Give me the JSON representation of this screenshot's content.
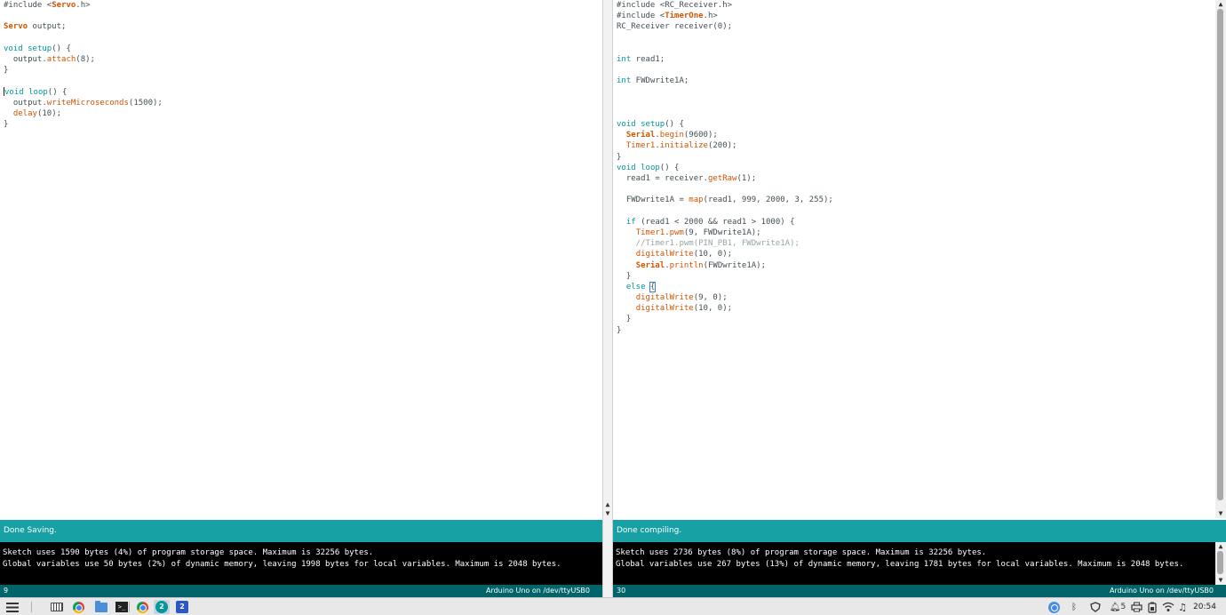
{
  "left_window": {
    "code_lines": [
      [
        {
          "t": "#include <",
          "c": ""
        },
        {
          "t": "Servo",
          "c": "ty"
        },
        {
          "t": ".h>",
          "c": ""
        }
      ],
      [],
      [
        {
          "t": "Servo",
          "c": "ty"
        },
        {
          "t": " output;",
          "c": ""
        }
      ],
      [],
      [
        {
          "t": "void",
          "c": "kw"
        },
        {
          "t": " ",
          "c": ""
        },
        {
          "t": "setup",
          "c": "kw"
        },
        {
          "t": "() {",
          "c": ""
        }
      ],
      [
        {
          "t": "  output.",
          "c": ""
        },
        {
          "t": "attach",
          "c": "fn"
        },
        {
          "t": "(8);",
          "c": ""
        }
      ],
      [
        {
          "t": "}",
          "c": ""
        }
      ],
      [],
      [
        {
          "t": "void",
          "c": "kw",
          "cursor": true
        },
        {
          "t": " ",
          "c": ""
        },
        {
          "t": "loop",
          "c": "kw"
        },
        {
          "t": "() {",
          "c": ""
        }
      ],
      [
        {
          "t": "  output.",
          "c": ""
        },
        {
          "t": "writeMicroseconds",
          "c": "fn"
        },
        {
          "t": "(1500);",
          "c": ""
        }
      ],
      [
        {
          "t": "  ",
          "c": ""
        },
        {
          "t": "delay",
          "c": "fn"
        },
        {
          "t": "(10);",
          "c": ""
        }
      ],
      [
        {
          "t": "}",
          "c": ""
        }
      ]
    ],
    "status_text": "Done Saving.",
    "console_lines": [
      "Sketch uses 1590 bytes (4%) of program storage space. Maximum is 32256 bytes.",
      "Global variables use 50 bytes (2%) of dynamic memory, leaving 1998 bytes for local variables. Maximum is 2048 bytes."
    ],
    "line_number": "9",
    "board": "Arduino Uno on /dev/ttyUSB0"
  },
  "right_window": {
    "code_lines": [
      [
        {
          "t": "#include <",
          "c": ""
        },
        {
          "t": "RC_Receiver",
          "c": ""
        },
        {
          "t": ".h>",
          "c": ""
        }
      ],
      [
        {
          "t": "#include <",
          "c": ""
        },
        {
          "t": "TimerOne",
          "c": "ty"
        },
        {
          "t": ".h>",
          "c": ""
        }
      ],
      [
        {
          "t": "RC_Receiver receiver(0);",
          "c": ""
        }
      ],
      [],
      [],
      [
        {
          "t": "int",
          "c": "kw"
        },
        {
          "t": " read1;",
          "c": ""
        }
      ],
      [],
      [
        {
          "t": "int",
          "c": "kw"
        },
        {
          "t": " FWDwrite1A;",
          "c": ""
        }
      ],
      [],
      [],
      [],
      [
        {
          "t": "void",
          "c": "kw"
        },
        {
          "t": " ",
          "c": ""
        },
        {
          "t": "setup",
          "c": "kw"
        },
        {
          "t": "() {",
          "c": ""
        }
      ],
      [
        {
          "t": "  ",
          "c": ""
        },
        {
          "t": "Serial",
          "c": "ty"
        },
        {
          "t": ".",
          "c": ""
        },
        {
          "t": "begin",
          "c": "fn"
        },
        {
          "t": "(9600);",
          "c": ""
        }
      ],
      [
        {
          "t": "  ",
          "c": ""
        },
        {
          "t": "Timer1",
          "c": "fn"
        },
        {
          "t": ".",
          "c": ""
        },
        {
          "t": "initialize",
          "c": "fn"
        },
        {
          "t": "(200);",
          "c": ""
        }
      ],
      [
        {
          "t": "}",
          "c": ""
        }
      ],
      [
        {
          "t": "void",
          "c": "kw"
        },
        {
          "t": " ",
          "c": ""
        },
        {
          "t": "loop",
          "c": "kw"
        },
        {
          "t": "() {",
          "c": ""
        }
      ],
      [
        {
          "t": "  read1 = receiver.",
          "c": ""
        },
        {
          "t": "getRaw",
          "c": "fn"
        },
        {
          "t": "(1);",
          "c": ""
        }
      ],
      [],
      [
        {
          "t": "  FWDwrite1A = ",
          "c": ""
        },
        {
          "t": "map",
          "c": "fn"
        },
        {
          "t": "(read1, 999, 2000, 3, 255);",
          "c": ""
        }
      ],
      [],
      [
        {
          "t": "  ",
          "c": ""
        },
        {
          "t": "if",
          "c": "kw"
        },
        {
          "t": " (read1 < 2000 && read1 > 1000) {",
          "c": ""
        }
      ],
      [
        {
          "t": "    ",
          "c": ""
        },
        {
          "t": "Timer1",
          "c": "fn"
        },
        {
          "t": ".",
          "c": ""
        },
        {
          "t": "pwm",
          "c": "fn"
        },
        {
          "t": "(9, FWDwrite1A);",
          "c": ""
        }
      ],
      [
        {
          "t": "    //Timer1.pwm(PIN_PB1, FWDwrite1A);",
          "c": "cm"
        }
      ],
      [
        {
          "t": "    ",
          "c": ""
        },
        {
          "t": "digitalWrite",
          "c": "fn"
        },
        {
          "t": "(10, 0);",
          "c": ""
        }
      ],
      [
        {
          "t": "    ",
          "c": ""
        },
        {
          "t": "Serial",
          "c": "ty"
        },
        {
          "t": ".",
          "c": ""
        },
        {
          "t": "println",
          "c": "fn"
        },
        {
          "t": "(FWDwrite1A);",
          "c": ""
        }
      ],
      [
        {
          "t": "  }",
          "c": ""
        }
      ],
      [
        {
          "t": "  ",
          "c": ""
        },
        {
          "t": "else",
          "c": "kw"
        },
        {
          "t": " ",
          "c": ""
        },
        {
          "t": "{",
          "c": "",
          "bracket": true
        }
      ],
      [
        {
          "t": "    ",
          "c": ""
        },
        {
          "t": "digitalWrite",
          "c": "fn"
        },
        {
          "t": "(9, 0);",
          "c": ""
        }
      ],
      [
        {
          "t": "    ",
          "c": ""
        },
        {
          "t": "digitalWrite",
          "c": "fn"
        },
        {
          "t": "(10, 0);",
          "c": ""
        }
      ],
      [
        {
          "t": "  }",
          "c": ""
        }
      ],
      [
        {
          "t": "}",
          "c": ""
        }
      ]
    ],
    "status_text": "Done compiling.",
    "console_lines": [
      "Sketch uses 2736 bytes (8%) of program storage space. Maximum is 32256 bytes.",
      "Global variables use 267 bytes (13%) of dynamic memory, leaving 1781 bytes for local variables. Maximum is 2048 bytes."
    ],
    "line_number": "30",
    "board": "Arduino Uno on /dev/ttyUSB0"
  },
  "taskbar": {
    "arduino_badge_1": "2",
    "arduino_badge_2": "2",
    "notification_count": "5",
    "clock": "20:54"
  },
  "colors": {
    "status_bar": "#17a1a5",
    "footer_bar": "#006468",
    "keyword": "#00979c",
    "function": "#d35400",
    "comment": "#95a5a6"
  }
}
